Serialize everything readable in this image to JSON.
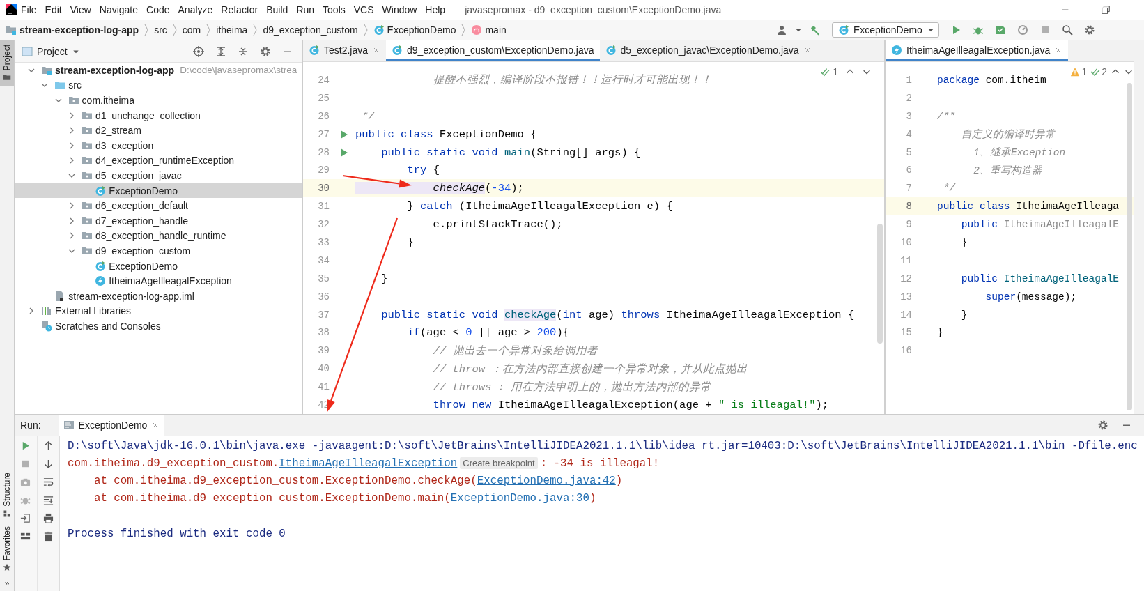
{
  "menu": {
    "items": [
      "File",
      "Edit",
      "View",
      "Navigate",
      "Code",
      "Analyze",
      "Refactor",
      "Build",
      "Run",
      "Tools",
      "VCS",
      "Window",
      "Help"
    ],
    "title": "javasepromax - d9_exception_custom\\ExceptionDemo.java"
  },
  "breadcrumbs": [
    {
      "label": "stream-exception-log-app",
      "kind": "module"
    },
    {
      "label": "src",
      "kind": "plain"
    },
    {
      "label": "com",
      "kind": "plain"
    },
    {
      "label": "itheima",
      "kind": "plain"
    },
    {
      "label": "d9_exception_custom",
      "kind": "plain"
    },
    {
      "label": "ExceptionDemo",
      "kind": "class"
    },
    {
      "label": "main",
      "kind": "method"
    }
  ],
  "run_config": "ExceptionDemo",
  "tool_strip": {
    "top": [
      {
        "label": "Project",
        "selected": true
      }
    ],
    "bottom": [
      {
        "label": "Structure",
        "kind": "structure",
        "selected": false
      },
      {
        "label": "Favorites",
        "kind": "star",
        "selected": false
      }
    ],
    "more": "»"
  },
  "project": {
    "title": "Project",
    "tree": [
      {
        "label": "stream-exception-log-app",
        "path": "D:\\code\\javasepromax\\strea",
        "kind": "module",
        "expanded": true,
        "selected": false,
        "children": [
          {
            "label": "src",
            "kind": "source",
            "expanded": true,
            "selected": false,
            "children": [
              {
                "label": "com.itheima",
                "kind": "package",
                "expanded": true,
                "selected": false,
                "children": [
                  {
                    "label": "d1_unchange_collection",
                    "kind": "package",
                    "expanded": false,
                    "selected": false
                  },
                  {
                    "label": "d2_stream",
                    "kind": "package",
                    "expanded": false,
                    "selected": false
                  },
                  {
                    "label": "d3_exception",
                    "kind": "package",
                    "expanded": false,
                    "selected": false
                  },
                  {
                    "label": "d4_exception_runtimeException",
                    "kind": "package",
                    "expanded": false,
                    "selected": false
                  },
                  {
                    "label": "d5_exception_javac",
                    "kind": "package",
                    "expanded": true,
                    "selected": false,
                    "children": [
                      {
                        "label": "ExceptionDemo",
                        "kind": "class",
                        "selected": true
                      }
                    ]
                  },
                  {
                    "label": "d6_exception_default",
                    "kind": "package",
                    "expanded": false,
                    "selected": false
                  },
                  {
                    "label": "d7_exception_handle",
                    "kind": "package",
                    "expanded": false,
                    "selected": false
                  },
                  {
                    "label": "d8_exception_handle_runtime",
                    "kind": "package",
                    "expanded": false,
                    "selected": false
                  },
                  {
                    "label": "d9_exception_custom",
                    "kind": "package",
                    "expanded": true,
                    "selected": false,
                    "children": [
                      {
                        "label": "ExceptionDemo",
                        "kind": "class",
                        "selected": false
                      },
                      {
                        "label": "ItheimaAgeIlleagalException",
                        "kind": "exception",
                        "selected": false
                      }
                    ]
                  }
                ]
              }
            ]
          },
          {
            "label": "stream-exception-log-app.iml",
            "kind": "iml",
            "selected": false
          }
        ]
      },
      {
        "label": "External Libraries",
        "kind": "libraries",
        "expanded": false,
        "selected": false
      },
      {
        "label": "Scratches and Consoles",
        "kind": "scratches",
        "selected": false
      }
    ]
  },
  "editor": {
    "tabs": [
      {
        "label": "Test2.java",
        "kind": "class",
        "selected": false,
        "closable": true
      },
      {
        "label": "d9_exception_custom\\ExceptionDemo.java",
        "kind": "class",
        "selected": true,
        "closable": false
      },
      {
        "label": "d5_exception_javac\\ExceptionDemo.java",
        "kind": "class",
        "selected": false,
        "closable": true
      }
    ],
    "inspections": [
      {
        "kind": "ok",
        "count": "1"
      }
    ],
    "lines": [
      {
        "n": "24",
        "run": false,
        "current": false,
        "tokens": [
          {
            "text": "            提醒不强烈，编译阶段不报错！！运行时才可能出现！！",
            "kind": "cm"
          }
        ]
      },
      {
        "n": "25",
        "run": false,
        "current": false
      },
      {
        "n": "26",
        "run": false,
        "current": false,
        "tokens": [
          {
            "text": " */",
            "kind": "cm"
          }
        ]
      },
      {
        "n": "27",
        "run": true,
        "current": false,
        "tokens": [
          {
            "text": "public class ",
            "kind": "kw"
          },
          {
            "text": "ExceptionDemo {"
          }
        ]
      },
      {
        "n": "28",
        "run": true,
        "current": false,
        "tokens": [
          {
            "text": "    public static void ",
            "kind": "kw"
          },
          {
            "text": "main",
            "kind": "fn"
          },
          {
            "text": "(String[] args) {"
          }
        ]
      },
      {
        "n": "29",
        "run": false,
        "current": false,
        "tokens": [
          {
            "text": "        try ",
            "kind": "kw"
          },
          {
            "text": "{"
          }
        ]
      },
      {
        "n": "30",
        "run": false,
        "current": true,
        "tokens": [
          {
            "text": "            checkAge",
            "kind": "call-hl"
          },
          {
            "text": "("
          },
          {
            "text": "-34",
            "kind": "num"
          },
          {
            "text": ");"
          }
        ]
      },
      {
        "n": "31",
        "run": false,
        "current": false,
        "tokens": [
          {
            "text": "        } "
          },
          {
            "text": "catch ",
            "kind": "kw"
          },
          {
            "text": "(ItheimaAgeIlleagalException e) {"
          }
        ]
      },
      {
        "n": "32",
        "run": false,
        "current": false,
        "tokens": [
          {
            "text": "            e.printStackTrace();"
          }
        ]
      },
      {
        "n": "33",
        "run": false,
        "current": false,
        "tokens": [
          {
            "text": "        }"
          }
        ]
      },
      {
        "n": "34",
        "run": false,
        "current": false
      },
      {
        "n": "35",
        "run": false,
        "current": false,
        "tokens": [
          {
            "text": "    }"
          }
        ]
      },
      {
        "n": "36",
        "run": false,
        "current": false
      },
      {
        "n": "37",
        "run": false,
        "current": false,
        "tokens": [
          {
            "text": "    public static void ",
            "kind": "kw"
          },
          {
            "text": "checkAge",
            "kind": "fn-hl"
          },
          {
            "text": "("
          },
          {
            "text": "int ",
            "kind": "kw"
          },
          {
            "text": "age) "
          },
          {
            "text": "throws ",
            "kind": "kw"
          },
          {
            "text": "ItheimaAgeIlleagalException {"
          }
        ]
      },
      {
        "n": "38",
        "run": false,
        "current": false,
        "tokens": [
          {
            "text": "        if",
            "kind": "kw"
          },
          {
            "text": "(age < "
          },
          {
            "text": "0",
            "kind": "num"
          },
          {
            "text": " || age > "
          },
          {
            "text": "200",
            "kind": "num"
          },
          {
            "text": "){"
          }
        ]
      },
      {
        "n": "39",
        "run": false,
        "current": false,
        "tokens": [
          {
            "text": "            // 抛出去一个异常对象给调用者",
            "kind": "cm"
          }
        ]
      },
      {
        "n": "40",
        "run": false,
        "current": false,
        "tokens": [
          {
            "text": "            // throw ：在方法内部直接创建一个异常对象，并从此点抛出",
            "kind": "cm"
          }
        ]
      },
      {
        "n": "41",
        "run": false,
        "current": false,
        "tokens": [
          {
            "text": "            // throws : 用在方法申明上的，抛出方法内部的异常",
            "kind": "cm"
          }
        ]
      },
      {
        "n": "42",
        "run": false,
        "current": false,
        "tokens": [
          {
            "text": "            throw new ",
            "kind": "kw"
          },
          {
            "text": "ItheimaAgeIlleagalException(age + "
          },
          {
            "text": "\" is illeagal!\"",
            "kind": "str"
          },
          {
            "text": ");"
          }
        ]
      }
    ]
  },
  "side_editor": {
    "tabs": [
      {
        "label": "ItheimaAgeIlleagalException.java",
        "kind": "exception",
        "selected": true,
        "closable": true
      }
    ],
    "inspections": [
      {
        "kind": "warning",
        "count": "1"
      },
      {
        "kind": "ok",
        "count": "2"
      }
    ],
    "lines": [
      {
        "n": "1",
        "current": false,
        "tokens": [
          {
            "text": "package ",
            "kind": "kw"
          },
          {
            "text": "com.itheim"
          }
        ]
      },
      {
        "n": "2",
        "current": false
      },
      {
        "n": "3",
        "current": false,
        "tokens": [
          {
            "text": "/**",
            "kind": "cm"
          }
        ]
      },
      {
        "n": "4",
        "current": false,
        "tokens": [
          {
            "text": "    自定义的编译时异常",
            "kind": "cm"
          }
        ]
      },
      {
        "n": "5",
        "current": false,
        "tokens": [
          {
            "text": "      1、继承Exception",
            "kind": "cm"
          }
        ]
      },
      {
        "n": "6",
        "current": false,
        "tokens": [
          {
            "text": "      2、重写构造器",
            "kind": "cm"
          }
        ]
      },
      {
        "n": "7",
        "current": false,
        "tokens": [
          {
            "text": " */",
            "kind": "cm"
          }
        ]
      },
      {
        "n": "8",
        "current": true,
        "tokens": [
          {
            "text": "public class ",
            "kind": "kw"
          },
          {
            "text": "ItheimaAgeIlleaga"
          }
        ]
      },
      {
        "n": "9",
        "current": false,
        "tokens": [
          {
            "text": "    public ",
            "kind": "kw"
          },
          {
            "text": "ItheimaAgeIlleagalE",
            "kind": "unused"
          }
        ]
      },
      {
        "n": "10",
        "current": false,
        "tokens": [
          {
            "text": "    }"
          }
        ]
      },
      {
        "n": "11",
        "current": false
      },
      {
        "n": "12",
        "current": false,
        "tokens": [
          {
            "text": "    public ",
            "kind": "kw"
          },
          {
            "text": "ItheimaAgeIlleagalE",
            "kind": "fn"
          }
        ]
      },
      {
        "n": "13",
        "current": false,
        "tokens": [
          {
            "text": "        super",
            "kind": "kw"
          },
          {
            "text": "(message);"
          }
        ]
      },
      {
        "n": "14",
        "current": false,
        "tokens": [
          {
            "text": "    }"
          }
        ]
      },
      {
        "n": "15",
        "current": false,
        "tokens": [
          {
            "text": "}"
          }
        ]
      },
      {
        "n": "16",
        "current": false
      }
    ]
  },
  "run_panel": {
    "label": "Run:",
    "tabs": [
      {
        "label": "ExceptionDemo",
        "selected": true
      }
    ],
    "console": [
      {
        "kind": "cmd",
        "segments": [
          {
            "text": "D:\\soft\\Java\\jdk-16.0.1\\bin\\java.exe -javaagent:D:\\soft\\JetBrains\\IntelliJIDEA2021.1.1\\lib\\idea_rt.jar=10403:D:\\soft\\JetBrains\\IntelliJIDEA2021.1.1\\bin -Dfile.enc"
          }
        ]
      },
      {
        "kind": "err",
        "segments": [
          {
            "text": "com.itheima.d9_exception_custom."
          },
          {
            "text": "ItheimaAgeIlleagalException",
            "kind": "link"
          },
          {
            "text": "Create breakpoint",
            "kind": "hint"
          },
          {
            "text": ": -34 is illeagal!"
          }
        ]
      },
      {
        "kind": "err",
        "segments": [
          {
            "text": "    at com.itheima.d9_exception_custom.ExceptionDemo.checkAge("
          },
          {
            "text": "ExceptionDemo.java:42",
            "kind": "link"
          },
          {
            "text": ")"
          }
        ]
      },
      {
        "kind": "err",
        "segments": [
          {
            "text": "    at com.itheima.d9_exception_custom.ExceptionDemo.main("
          },
          {
            "text": "ExceptionDemo.java:30",
            "kind": "link"
          },
          {
            "text": ")"
          }
        ]
      },
      {
        "kind": "status",
        "segments": [
          {
            "text": "Process finished with exit code 0"
          }
        ]
      }
    ]
  }
}
